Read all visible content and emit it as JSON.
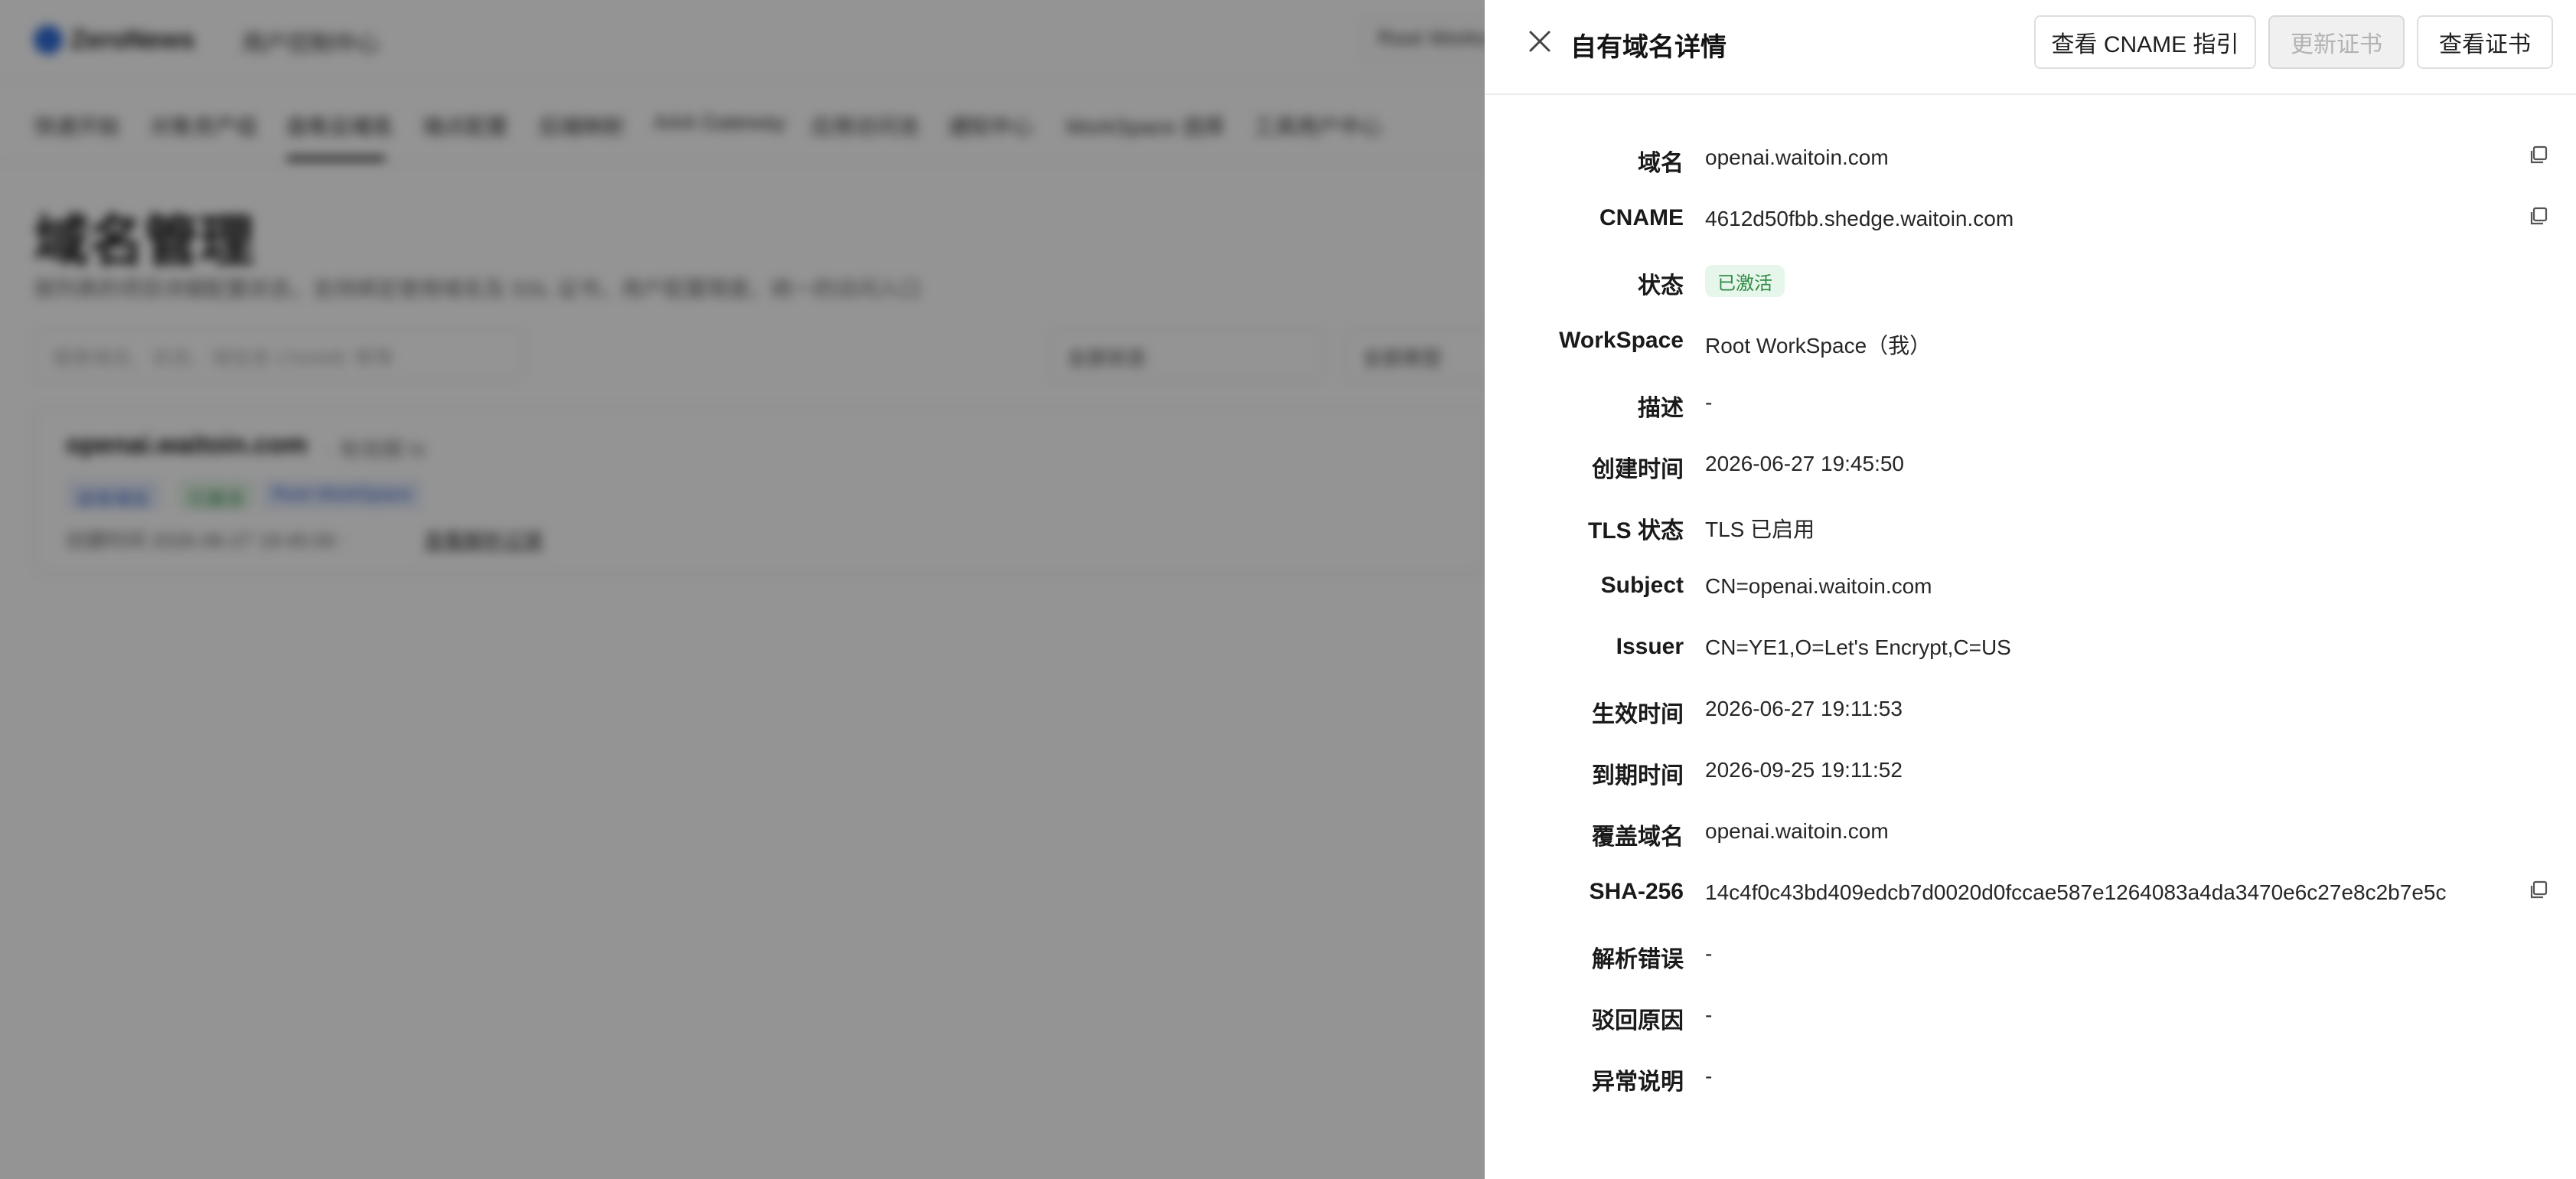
{
  "background": {
    "logo_text": "ZeroNews",
    "console_name": "用户控制中心",
    "workspace_switch": "Root Works",
    "nav": [
      "快速开始",
      "对象资产组",
      "自有云域名",
      "端点配置",
      "后端映射",
      "AAA Gateway",
      "应用访问池",
      "通知中心",
      "WorkSpace 选择",
      "工具用户中心"
    ],
    "page_title": "域名管理",
    "page_subtitle": "按列表的项目详细配置状态，支持绑定使用域名及 SSL 证书，用户配置限度，统一的访问入口",
    "search_placeholder": "搜索域名、状态、域信息 CNAME 等等",
    "filter_status": "全部状态",
    "filter_type": "全部类型",
    "card": {
      "domain": "openai.waitoin.com",
      "sub": "· 有效期 N",
      "tags": [
        "自有域名",
        "已激活",
        "Root WorkSpace"
      ],
      "meta": "创建时间  2026-06-27 19:45:50  ·",
      "link": "查看解析记录"
    }
  },
  "drawer": {
    "title": "自有域名详情",
    "buttons": {
      "cname_guide": "查看 CNAME 指引",
      "renew_cert": "更新证书",
      "view_cert": "查看证书"
    },
    "rows": [
      {
        "label": "域名",
        "value": "openai.waitoin.com",
        "copy": true
      },
      {
        "label": "CNAME",
        "value": "4612d50fbb.shedge.waitoin.com",
        "copy": true
      },
      {
        "label": "状态",
        "value": "已激活",
        "badge": true
      },
      {
        "label": "WorkSpace",
        "value": "Root WorkSpace（我）"
      },
      {
        "label": "描述",
        "value": "-"
      },
      {
        "label": "创建时间",
        "value": "2026-06-27 19:45:50"
      },
      {
        "label": "TLS 状态",
        "value": "TLS 已启用"
      },
      {
        "label": "Subject",
        "value": "CN=openai.waitoin.com"
      },
      {
        "label": "Issuer",
        "value": "CN=YE1,O=Let's Encrypt,C=US"
      },
      {
        "label": "生效时间",
        "value": "2026-06-27 19:11:53"
      },
      {
        "label": "到期时间",
        "value": "2026-09-25 19:11:52"
      },
      {
        "label": "覆盖域名",
        "value": "openai.waitoin.com"
      },
      {
        "label": "SHA-256",
        "value": "14c4f0c43bd409edcb7d0020d0fccae587e1264083a4da3470e6c27e8c2b7e5c",
        "copy": true
      },
      {
        "label": "解析错误",
        "value": "-"
      },
      {
        "label": "驳回原因",
        "value": "-"
      },
      {
        "label": "异常说明",
        "value": "-"
      }
    ]
  },
  "colors": {
    "badge_bg": "#e7f6ea",
    "badge_text": "#2f8a44",
    "overlay": "rgba(0,0,0,0.42)"
  }
}
